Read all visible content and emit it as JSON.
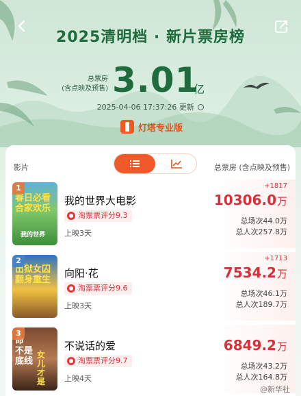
{
  "colors": {
    "accent": "#f05a2a",
    "green_title": "#1f6b3e",
    "box_red": "#d6303a"
  },
  "header": {
    "back_icon": "chevron-left-icon",
    "share_icon": "share-icon",
    "title": "2025清明档 · 新片票房榜",
    "total_label_1": "总票房",
    "total_label_2": "(含点映及预售)",
    "total_value": "3.01",
    "total_unit": "亿",
    "update_time": "2025-04-06 17:37:26 更新",
    "brand": "灯塔专业版"
  },
  "list": {
    "col_film": "影片",
    "col_box": "总票房 (含点映及预售)",
    "view_toggle": [
      "list-icon",
      "chart-icon"
    ],
    "films": [
      {
        "rank": "1",
        "name": "我的世界大电影",
        "poster_text": [
          "春日必看",
          "合家欢乐"
        ],
        "poster_sub": "我的世界",
        "rating": "淘票票评分9.3",
        "days": "上映3天",
        "delta": "+1817",
        "box": "10306.0",
        "box_unit": "万",
        "shows": "总场次44.0万",
        "people": "总人次257.8万"
      },
      {
        "rank": "2",
        "name": "向阳·花",
        "poster_text": [
          "出狱女囚",
          "翻身重生"
        ],
        "poster_sub": "",
        "rating": "淘票票评分9.6",
        "days": "上映3天",
        "delta": "+1713",
        "box": "7534.2",
        "box_unit": "万",
        "shows": "总场次46.1万",
        "people": "总人次189.7万"
      },
      {
        "rank": "3",
        "name": "不说话的爱",
        "poster_text": [
          "命",
          "不是",
          "底线"
        ],
        "poster_sub": "女儿才是",
        "rating": "淘票票评分9.7",
        "days": "上映4天",
        "delta": "",
        "box": "6849.2",
        "box_unit": "万",
        "shows": "总场次43.2万",
        "people": "总人次164.8万"
      }
    ]
  },
  "watermark": "@新华社"
}
